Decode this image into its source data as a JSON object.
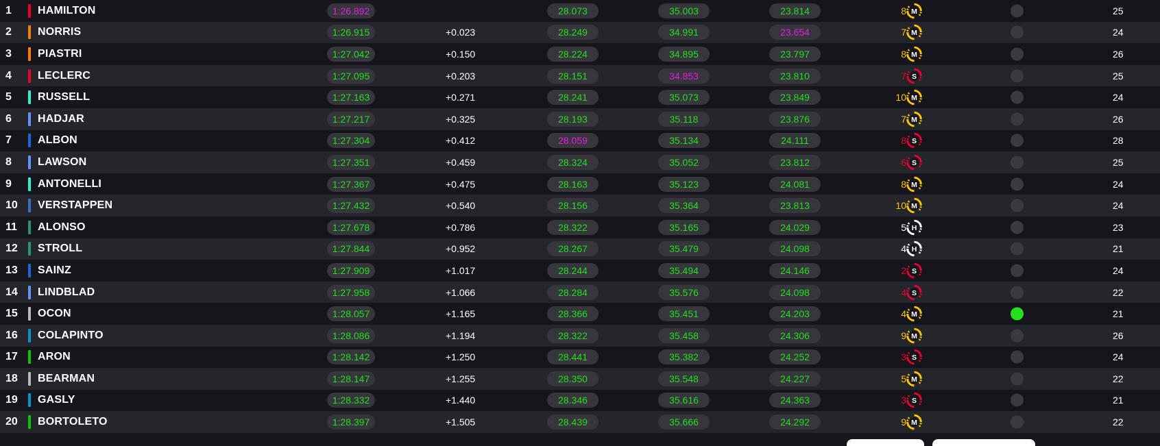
{
  "colors": {
    "sector_green": "#22e01e",
    "sector_purple": "#e51ee5",
    "tyre_medium": "#ffc400",
    "tyre_soft": "#e8002d",
    "tyre_hard": "#ffffff",
    "active_dot": "#22e01e",
    "inactive_dot": "#3a3a3f"
  },
  "rows": [
    {
      "pos": "1",
      "name": "HAMILTON",
      "team_color": "#e8002d",
      "lap": "1:26.892",
      "lap_color": "purple",
      "gap": "",
      "s1": "28.073",
      "s1_color": "green",
      "s2": "35.003",
      "s2_color": "green",
      "s3": "23.814",
      "s3_color": "green",
      "stint": "8",
      "tyre": "M",
      "tyre_icon": "medium-tyre-icon",
      "active": false,
      "laps": "25"
    },
    {
      "pos": "2",
      "name": "NORRIS",
      "team_color": "#ff8000",
      "lap": "1:26.915",
      "lap_color": "green",
      "gap": "+0.023",
      "s1": "28.249",
      "s1_color": "green",
      "s2": "34.991",
      "s2_color": "green",
      "s3": "23.654",
      "s3_color": "purple",
      "stint": "7",
      "tyre": "M",
      "tyre_icon": "medium-tyre-icon",
      "active": false,
      "laps": "24"
    },
    {
      "pos": "3",
      "name": "PIASTRI",
      "team_color": "#ff8000",
      "lap": "1:27.042",
      "lap_color": "green",
      "gap": "+0.150",
      "s1": "28.224",
      "s1_color": "green",
      "s2": "34.895",
      "s2_color": "green",
      "s3": "23.797",
      "s3_color": "green",
      "stint": "8",
      "tyre": "M",
      "tyre_icon": "medium-tyre-icon",
      "active": false,
      "laps": "26"
    },
    {
      "pos": "4",
      "name": "LECLERC",
      "team_color": "#e8002d",
      "lap": "1:27.095",
      "lap_color": "green",
      "gap": "+0.203",
      "s1": "28.151",
      "s1_color": "green",
      "s2": "34.853",
      "s2_color": "purple",
      "s3": "23.810",
      "s3_color": "green",
      "stint": "7",
      "tyre": "S",
      "tyre_icon": "soft-tyre-icon",
      "active": false,
      "laps": "25"
    },
    {
      "pos": "5",
      "name": "RUSSELL",
      "team_color": "#27f4d2",
      "lap": "1:27.163",
      "lap_color": "green",
      "gap": "+0.271",
      "s1": "28.241",
      "s1_color": "green",
      "s2": "35.073",
      "s2_color": "green",
      "s3": "23.849",
      "s3_color": "green",
      "stint": "10",
      "tyre": "M",
      "tyre_icon": "medium-tyre-icon",
      "active": false,
      "laps": "24"
    },
    {
      "pos": "6",
      "name": "HADJAR",
      "team_color": "#6692ff",
      "lap": "1:27.217",
      "lap_color": "green",
      "gap": "+0.325",
      "s1": "28.193",
      "s1_color": "green",
      "s2": "35.118",
      "s2_color": "green",
      "s3": "23.876",
      "s3_color": "green",
      "stint": "7",
      "tyre": "M",
      "tyre_icon": "medium-tyre-icon",
      "active": false,
      "laps": "26"
    },
    {
      "pos": "7",
      "name": "ALBON",
      "team_color": "#1868db",
      "lap": "1:27.304",
      "lap_color": "green",
      "gap": "+0.412",
      "s1": "28.059",
      "s1_color": "purple",
      "s2": "35.134",
      "s2_color": "green",
      "s3": "24.111",
      "s3_color": "green",
      "stint": "8",
      "tyre": "S",
      "tyre_icon": "soft-tyre-icon",
      "active": false,
      "laps": "28"
    },
    {
      "pos": "8",
      "name": "LAWSON",
      "team_color": "#6692ff",
      "lap": "1:27.351",
      "lap_color": "green",
      "gap": "+0.459",
      "s1": "28.324",
      "s1_color": "green",
      "s2": "35.052",
      "s2_color": "green",
      "s3": "23.812",
      "s3_color": "green",
      "stint": "6",
      "tyre": "S",
      "tyre_icon": "soft-tyre-icon",
      "active": false,
      "laps": "25"
    },
    {
      "pos": "9",
      "name": "ANTONELLI",
      "team_color": "#27f4d2",
      "lap": "1:27.367",
      "lap_color": "green",
      "gap": "+0.475",
      "s1": "28.163",
      "s1_color": "green",
      "s2": "35.123",
      "s2_color": "green",
      "s3": "24.081",
      "s3_color": "green",
      "stint": "8",
      "tyre": "M",
      "tyre_icon": "medium-tyre-icon",
      "active": false,
      "laps": "24"
    },
    {
      "pos": "10",
      "name": "VERSTAPPEN",
      "team_color": "#3671c6",
      "lap": "1:27.432",
      "lap_color": "green",
      "gap": "+0.540",
      "s1": "28.156",
      "s1_color": "green",
      "s2": "35.364",
      "s2_color": "green",
      "s3": "23.813",
      "s3_color": "green",
      "stint": "10",
      "tyre": "M",
      "tyre_icon": "medium-tyre-icon",
      "active": false,
      "laps": "24"
    },
    {
      "pos": "11",
      "name": "ALONSO",
      "team_color": "#229971",
      "lap": "1:27.678",
      "lap_color": "green",
      "gap": "+0.786",
      "s1": "28.322",
      "s1_color": "green",
      "s2": "35.165",
      "s2_color": "green",
      "s3": "24.029",
      "s3_color": "green",
      "stint": "5",
      "tyre": "H",
      "tyre_icon": "hard-tyre-icon",
      "active": false,
      "laps": "23"
    },
    {
      "pos": "12",
      "name": "STROLL",
      "team_color": "#229971",
      "lap": "1:27.844",
      "lap_color": "green",
      "gap": "+0.952",
      "s1": "28.267",
      "s1_color": "green",
      "s2": "35.479",
      "s2_color": "green",
      "s3": "24.098",
      "s3_color": "green",
      "stint": "4",
      "tyre": "H",
      "tyre_icon": "hard-tyre-icon",
      "active": false,
      "laps": "21"
    },
    {
      "pos": "13",
      "name": "SAINZ",
      "team_color": "#1868db",
      "lap": "1:27.909",
      "lap_color": "green",
      "gap": "+1.017",
      "s1": "28.244",
      "s1_color": "green",
      "s2": "35.494",
      "s2_color": "green",
      "s3": "24.146",
      "s3_color": "green",
      "stint": "2",
      "tyre": "S",
      "tyre_icon": "soft-tyre-icon",
      "active": false,
      "laps": "24"
    },
    {
      "pos": "14",
      "name": "LINDBLAD",
      "team_color": "#6692ff",
      "lap": "1:27.958",
      "lap_color": "green",
      "gap": "+1.066",
      "s1": "28.284",
      "s1_color": "green",
      "s2": "35.576",
      "s2_color": "green",
      "s3": "24.098",
      "s3_color": "green",
      "stint": "4",
      "tyre": "S",
      "tyre_icon": "soft-tyre-icon",
      "active": false,
      "laps": "22"
    },
    {
      "pos": "15",
      "name": "OCON",
      "team_color": "#b6babd",
      "lap": "1:28.057",
      "lap_color": "green",
      "gap": "+1.165",
      "s1": "28.366",
      "s1_color": "green",
      "s2": "35.451",
      "s2_color": "green",
      "s3": "24.203",
      "s3_color": "green",
      "stint": "4",
      "tyre": "M",
      "tyre_icon": "medium-tyre-icon",
      "active": true,
      "laps": "21"
    },
    {
      "pos": "16",
      "name": "COLAPINTO",
      "team_color": "#0093cc",
      "lap": "1:28.086",
      "lap_color": "green",
      "gap": "+1.194",
      "s1": "28.322",
      "s1_color": "green",
      "s2": "35.458",
      "s2_color": "green",
      "s3": "24.306",
      "s3_color": "green",
      "stint": "9",
      "tyre": "M",
      "tyre_icon": "medium-tyre-icon",
      "active": false,
      "laps": "26"
    },
    {
      "pos": "17",
      "name": "ARON",
      "team_color": "#00c800",
      "lap": "1:28.142",
      "lap_color": "green",
      "gap": "+1.250",
      "s1": "28.441",
      "s1_color": "green",
      "s2": "35.382",
      "s2_color": "green",
      "s3": "24.252",
      "s3_color": "green",
      "stint": "3",
      "tyre": "S",
      "tyre_icon": "soft-tyre-icon",
      "active": false,
      "laps": "24"
    },
    {
      "pos": "18",
      "name": "BEARMAN",
      "team_color": "#b6babd",
      "lap": "1:28.147",
      "lap_color": "green",
      "gap": "+1.255",
      "s1": "28.350",
      "s1_color": "green",
      "s2": "35.548",
      "s2_color": "green",
      "s3": "24.227",
      "s3_color": "green",
      "stint": "5",
      "tyre": "M",
      "tyre_icon": "medium-tyre-icon",
      "active": false,
      "laps": "22"
    },
    {
      "pos": "19",
      "name": "GASLY",
      "team_color": "#0093cc",
      "lap": "1:28.332",
      "lap_color": "green",
      "gap": "+1.440",
      "s1": "28.346",
      "s1_color": "green",
      "s2": "35.616",
      "s2_color": "green",
      "s3": "24.363",
      "s3_color": "green",
      "stint": "3",
      "tyre": "S",
      "tyre_icon": "soft-tyre-icon",
      "active": false,
      "laps": "21"
    },
    {
      "pos": "20",
      "name": "BORTOLETO",
      "team_color": "#00c800",
      "lap": "1:28.397",
      "lap_color": "green",
      "gap": "+1.505",
      "s1": "28.439",
      "s1_color": "green",
      "s2": "35.666",
      "s2_color": "green",
      "s3": "24.292",
      "s3_color": "green",
      "stint": "9",
      "tyre": "M",
      "tyre_icon": "medium-tyre-icon",
      "active": false,
      "laps": "22"
    }
  ]
}
